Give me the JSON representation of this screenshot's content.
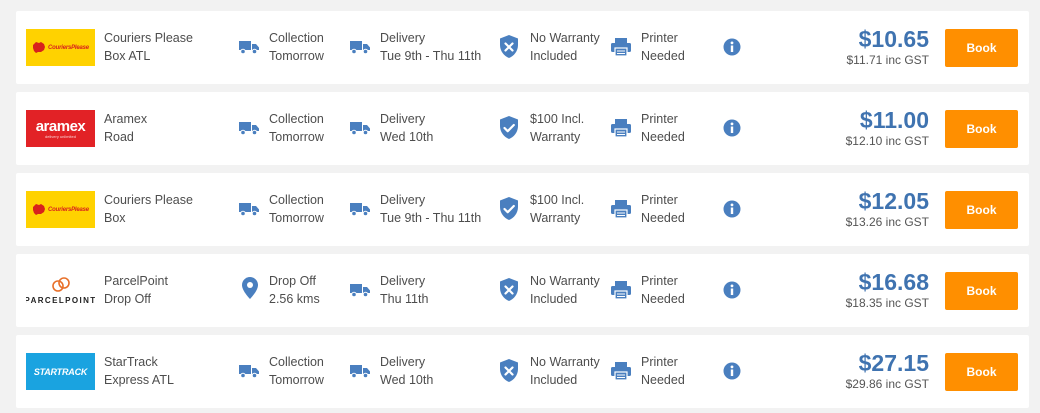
{
  "colors": {
    "price": "#3f73b0",
    "book_button": "#ff8f00",
    "icon": "#4a7fbf"
  },
  "quotes": [
    {
      "logo_text": "CouriersPlease",
      "logo_style": "cp",
      "carrier_line1": "Couriers Please",
      "carrier_line2": "Box ATL",
      "pickup_icon": "truck-icon",
      "pickup_line1": "Collection",
      "pickup_line2": "Tomorrow",
      "delivery_line1": "Delivery",
      "delivery_line2": "Tue 9th - Thu 11th",
      "warranty_icon": "shield-x-icon",
      "warranty_line1": "No Warranty",
      "warranty_line2": "Included",
      "printer_line1": "Printer",
      "printer_line2": "Needed",
      "price": "$10.65",
      "price_gst": "$11.71 inc GST",
      "book_label": "Book"
    },
    {
      "logo_text": "aramex",
      "logo_sub": "delivery unlimited",
      "logo_style": "ar",
      "carrier_line1": "Aramex",
      "carrier_line2": "Road",
      "pickup_icon": "truck-icon",
      "pickup_line1": "Collection",
      "pickup_line2": "Tomorrow",
      "delivery_line1": "Delivery",
      "delivery_line2": "Wed 10th",
      "warranty_icon": "shield-check-icon",
      "warranty_line1": "$100 Incl.",
      "warranty_line2": "Warranty",
      "printer_line1": "Printer",
      "printer_line2": "Needed",
      "price": "$11.00",
      "price_gst": "$12.10 inc GST",
      "book_label": "Book"
    },
    {
      "logo_text": "CouriersPlease",
      "logo_style": "cp",
      "carrier_line1": "Couriers Please",
      "carrier_line2": "Box",
      "pickup_icon": "truck-icon",
      "pickup_line1": "Collection",
      "pickup_line2": "Tomorrow",
      "delivery_line1": "Delivery",
      "delivery_line2": "Tue 9th - Thu 11th",
      "warranty_icon": "shield-check-icon",
      "warranty_line1": "$100 Incl.",
      "warranty_line2": "Warranty",
      "printer_line1": "Printer",
      "printer_line2": "Needed",
      "price": "$12.05",
      "price_gst": "$13.26 inc GST",
      "book_label": "Book"
    },
    {
      "logo_text": "PARCELPOINT",
      "logo_style": "pp",
      "carrier_line1": "ParcelPoint",
      "carrier_line2": "Drop Off",
      "pickup_icon": "map-pin-icon",
      "pickup_line1": "Drop Off",
      "pickup_line2": "2.56 kms",
      "delivery_line1": "Delivery",
      "delivery_line2": "Thu 11th",
      "warranty_icon": "shield-x-icon",
      "warranty_line1": "No Warranty",
      "warranty_line2": "Included",
      "printer_line1": "Printer",
      "printer_line2": "Needed",
      "price": "$16.68",
      "price_gst": "$18.35 inc GST",
      "book_label": "Book"
    },
    {
      "logo_text": "STARTRACK",
      "logo_style": "st",
      "carrier_line1": "StarTrack",
      "carrier_line2": "Express ATL",
      "pickup_icon": "truck-icon",
      "pickup_line1": "Collection",
      "pickup_line2": "Tomorrow",
      "delivery_line1": "Delivery",
      "delivery_line2": "Wed 10th",
      "warranty_icon": "shield-x-icon",
      "warranty_line1": "No Warranty",
      "warranty_line2": "Included",
      "printer_line1": "Printer",
      "printer_line2": "Needed",
      "price": "$27.15",
      "price_gst": "$29.86 inc GST",
      "book_label": "Book"
    }
  ]
}
